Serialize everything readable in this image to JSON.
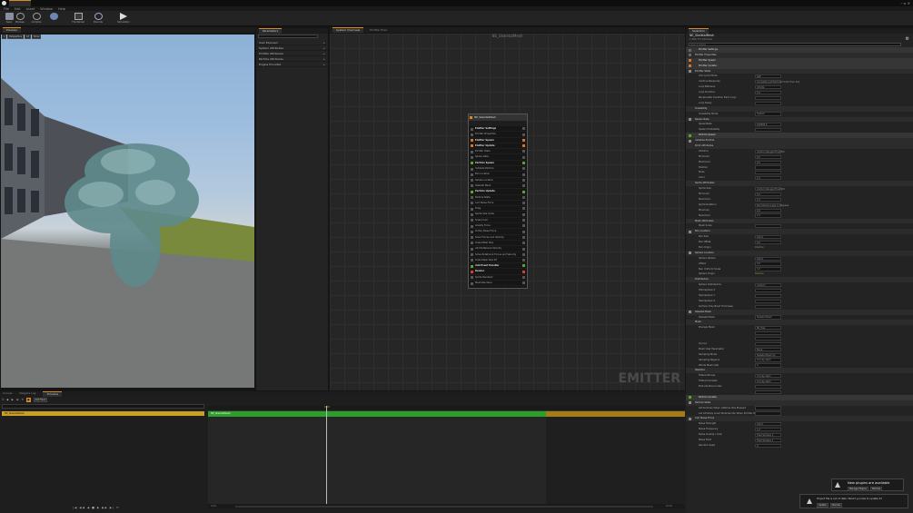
{
  "menu": [
    "File",
    "Edit",
    "Asset",
    "Window",
    "Help"
  ],
  "toolbar": [
    "Save",
    "Browse",
    "Compile",
    "Thumbnail",
    "Bounds",
    "Simulation"
  ],
  "viewport": {
    "tab": "Preview",
    "buttons": [
      "Perspective",
      "Lit",
      "Show"
    ]
  },
  "params": {
    "tab": "Parameters",
    "items": [
      "User Exposed",
      "System Attributes",
      "Emitter Attributes",
      "Particle Attributes",
      "Engine Provided"
    ]
  },
  "graph": {
    "tabs": [
      "System Overview",
      "Emitter Exec"
    ],
    "title": "NE_SkeletalMesh",
    "watermark": "EMITTER"
  },
  "node": {
    "title": "NE_SkeletalMesh",
    "rows": [
      {
        "t": "Emitter Settings",
        "h": true,
        "c": "#555"
      },
      {
        "t": "Emitter Properties",
        "h": false,
        "c": "#555"
      },
      {
        "t": "Emitter Spawn",
        "h": true,
        "c": "#d8742a"
      },
      {
        "t": "Emitter Update",
        "h": true,
        "c": "#d8742a"
      },
      {
        "t": "Emitter State",
        "h": false,
        "c": "#555"
      },
      {
        "t": "Spawn Rate",
        "h": false,
        "c": "#555"
      },
      {
        "t": "Particle Spawn",
        "h": true,
        "c": "#5aa62a"
      },
      {
        "t": "Initialize Particle",
        "h": false,
        "c": "#555"
      },
      {
        "t": "Box Location",
        "h": false,
        "c": "#555"
      },
      {
        "t": "Sphere Location",
        "h": false,
        "c": "#555"
      },
      {
        "t": "Skeletal Mesh",
        "h": false,
        "c": "#555"
      },
      {
        "t": "Particle Update",
        "h": true,
        "c": "#5aa62a"
      },
      {
        "t": "Particle State",
        "h": false,
        "c": "#555"
      },
      {
        "t": "Curl Noise Force",
        "h": false,
        "c": "#555"
      },
      {
        "t": "Drag",
        "h": false,
        "c": "#555"
      },
      {
        "t": "Sprite Size Scale",
        "h": false,
        "c": "#555"
      },
      {
        "t": "Scale Color",
        "h": false,
        "c": "#555"
      },
      {
        "t": "Gravity Force",
        "h": false,
        "c": "#555"
      },
      {
        "t": "Vortex Noise Force",
        "h": false,
        "c": "#555"
      },
      {
        "t": "Solve Forces and Velocity",
        "h": false,
        "c": "#555"
      },
      {
        "t": "Scale Mesh Size",
        "h": false,
        "c": "#555"
      },
      {
        "t": "Add Rotational Velocity",
        "h": false,
        "c": "#555"
      },
      {
        "t": "Solve Rotational Forces and Velocity",
        "h": false,
        "c": "#555"
      },
      {
        "t": "Scale Mesh Size RT",
        "h": false,
        "c": "#555"
      },
      {
        "t": "Add Event Handler",
        "h": true,
        "c": "#5aa62a"
      },
      {
        "t": "Render",
        "h": true,
        "c": "#d83a3a"
      },
      {
        "t": "Sprite Renderer",
        "h": false,
        "c": "#555"
      },
      {
        "t": "Mesh Renderer",
        "h": false,
        "c": "#555"
      }
    ]
  },
  "details": {
    "tab": "Selection",
    "name": "NE_SkeletalMesh",
    "sub": "1,800,772 Particles",
    "search": "Search Details",
    "rows": [
      {
        "t": "Emitter Settings",
        "k": "stage",
        "c": "#666"
      },
      {
        "t": "Emitter Properties",
        "k": "mod",
        "c": "#666"
      },
      {
        "t": "Emitter Spawn",
        "k": "stage",
        "c": "#d8742a"
      },
      {
        "t": "Emitter Update",
        "k": "stage",
        "c": "#d8742a"
      },
      {
        "t": "Emitter State",
        "k": "mod",
        "c": "#888"
      },
      {
        "t": "Life Cycle Mode",
        "v": "Self"
      },
      {
        "t": "Inactive Response",
        "v": "Complete (Let Particles Finish Then Kill)"
      },
      {
        "t": "Loop Behavior",
        "v": "Infinite"
      },
      {
        "t": "Loop Duration",
        "v": "5.0"
      },
      {
        "t": "Recalculate Duration Each Loop",
        "v": ""
      },
      {
        "t": "Loop Delay",
        "v": ""
      },
      {
        "t": "Scalability",
        "k": "mod",
        "c": ""
      },
      {
        "t": "Scalability Mode",
        "v": "System"
      },
      {
        "t": "Spawn Rate",
        "k": "mod",
        "c": "#888"
      },
      {
        "t": "SpawnRate",
        "v": "100000.0"
      },
      {
        "t": "Spawn Probability",
        "v": ""
      },
      {
        "t": "Particle Spawn",
        "k": "stage",
        "c": "#5aa62a"
      },
      {
        "t": "Initialize Particle",
        "k": "mod",
        "c": "#888"
      },
      {
        "t": "Point Attributes",
        "k": "mod",
        "c": ""
      },
      {
        "t": "Lifetime",
        "v": "Uniform Ranged Float 5/0"
      },
      {
        "t": "Minimum",
        "v": "0.5"
      },
      {
        "t": "Maximum",
        "v": "0.5"
      },
      {
        "t": "Position",
        "v": ""
      },
      {
        "t": "Mass",
        "v": ""
      },
      {
        "t": "Color",
        "v": "1.0"
      },
      {
        "t": "Sprite Attributes",
        "k": "mod",
        "c": ""
      },
      {
        "t": "Sprite Size",
        "v": "Uniform Ranged Float 9/0"
      },
      {
        "t": "Minimum",
        "v": "0.5"
      },
      {
        "t": "Maximum",
        "v": "1.0"
      },
      {
        "t": "Sprite Rotation",
        "v": "Normalized Angle to Degrees"
      },
      {
        "t": "Minimum",
        "v": "0.0"
      },
      {
        "t": "Maximum",
        "v": "1.0"
      },
      {
        "t": "Mesh Attributes",
        "k": "mod",
        "c": ""
      },
      {
        "t": "Mesh Scale",
        "v": ""
      },
      {
        "t": "Box Location",
        "k": "mod",
        "c": "#888"
      },
      {
        "t": "Box Size",
        "v": "100.0"
      },
      {
        "t": "Box Offset",
        "v": "0.0"
      },
      {
        "t": "Box Origin",
        "f": "Position"
      },
      {
        "t": "Sphere Location",
        "k": "mod",
        "c": "#888"
      },
      {
        "t": "Sphere Radius",
        "v": "100.0"
      },
      {
        "t": "Offset",
        "v": "0.0"
      },
      {
        "t": "Non Uniform Scale",
        "v": "1.0"
      },
      {
        "t": "Sphere Origin",
        "f": "Position"
      },
      {
        "t": "Distribution",
        "k": "mod",
        "c": ""
      },
      {
        "t": "Sphere Distribution",
        "v": "Uniform"
      },
      {
        "t": "Hemisphere X",
        "v": ""
      },
      {
        "t": "Hemisphere Y",
        "v": ""
      },
      {
        "t": "Hemisphere Z",
        "v": ""
      },
      {
        "t": "Surface Only Band Thickness",
        "v": ""
      },
      {
        "t": "Skeletal Mesh",
        "k": "mod",
        "c": "#888"
      },
      {
        "t": "Skeletal Mesh",
        "v": "Skeletal Mesh"
      },
      {
        "t": "Mesh",
        "k": "mod",
        "c": ""
      },
      {
        "t": "Preview Mesh",
        "v": "SK_Tree"
      },
      {
        "t": "",
        "v": ""
      },
      {
        "t": "",
        "v": ""
      },
      {
        "t": "Source",
        "v": ""
      },
      {
        "t": "Mesh User Parameter",
        "v": "None"
      },
      {
        "t": "Sampling Mode",
        "v": "Skeletal Mesh Sp"
      },
      {
        "t": "Sampling Regions",
        "v": "0 Array elem"
      },
      {
        "t": "Whole Mesh LOD",
        "v": "0"
      },
      {
        "t": "Skeleton",
        "k": "mod",
        "c": ""
      },
      {
        "t": "Filtered Bones",
        "v": "0 Array elem"
      },
      {
        "t": "Filtered Sockets",
        "v": "0 Array elem"
      },
      {
        "t": "Exclude Bone Index",
        "v": ""
      },
      {
        "t": "",
        "v": ""
      },
      {
        "t": "Particle Update",
        "k": "stage",
        "c": "#5aa62a"
      },
      {
        "t": "Particle State",
        "k": "mod",
        "c": "#888"
      },
      {
        "t": "Kill Particles When Lifetime Has Elapsed",
        "v": ""
      },
      {
        "t": "Let Infinitely Lived Particles Die When Emitter Deactivates",
        "v": ""
      },
      {
        "t": "Curl Noise Force",
        "k": "mod",
        "c": "#888"
      },
      {
        "t": "Noise Strength",
        "v": "100.0"
      },
      {
        "t": "Noise Frequency",
        "v": "1.0"
      },
      {
        "t": "Noise Quality / Cost",
        "v": "Tiled Simplex 1"
      },
      {
        "t": "Noise Field",
        "v": "Tiled Simplex 1"
      },
      {
        "t": "Random Seed",
        "v": "0"
      }
    ]
  },
  "notify1": {
    "title": "New plugins are available",
    "btns": [
      "Manage Plugins",
      "Dismiss"
    ]
  },
  "notify2": {
    "text": "Project file is out of date. Would you like to update it?",
    "btns": [
      "Update",
      "Dismiss"
    ]
  },
  "curves": {
    "tabs": [
      "Curves",
      "Niagara Log",
      "Timeline"
    ],
    "filter": "Add Track",
    "track": "NE_SkeletalMesh",
    "timeTop": "0.00",
    "timeStart": "0.00",
    "timeEnd": "10.00"
  }
}
